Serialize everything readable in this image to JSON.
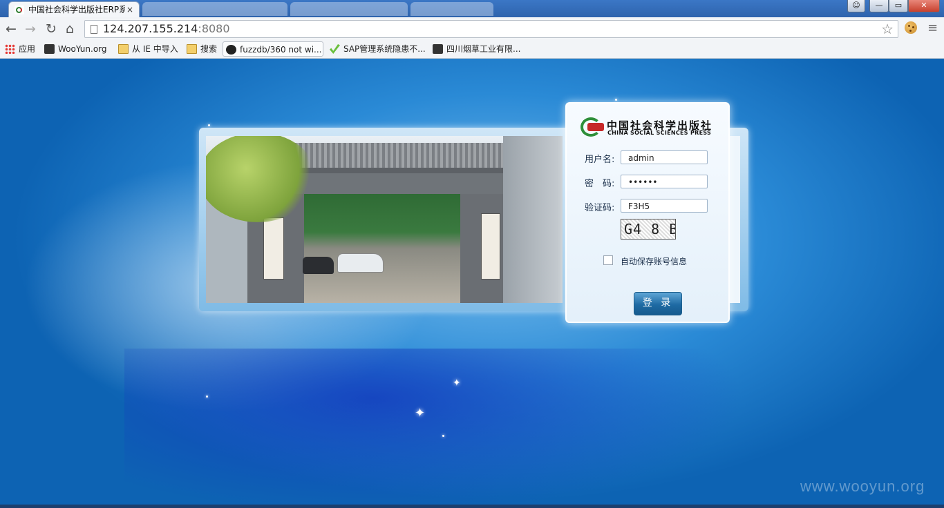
{
  "browser": {
    "tab_active_title": "中国社会科学出版社ERP系",
    "tab_close": "×",
    "url_host": "124.207.155.214",
    "url_port": ":8080",
    "window_controls": {
      "minimize": "—",
      "maximize": "▭",
      "close": "✕"
    }
  },
  "bookmarks": [
    {
      "label": "应用",
      "icon": "apps-icon"
    },
    {
      "label": "WooYun.org",
      "icon": "wooyun-icon"
    },
    {
      "label": "从 IE 中导入",
      "icon": "folder-icon"
    },
    {
      "label": "搜索",
      "icon": "folder-icon"
    },
    {
      "label": "fuzzdb/360 not wi...",
      "icon": "github-icon"
    },
    {
      "label": "SAP管理系统隐患不...",
      "icon": "sap-icon"
    },
    {
      "label": "四川烟草工业有限...",
      "icon": "wooyun-icon"
    }
  ],
  "login": {
    "logo_cn": "中国社会科学出版社",
    "logo_en": "CHINA SOCIAL SCIENCES PRESS",
    "username_label": "用户名:",
    "username_value": "admin",
    "password_label": "密　码:",
    "password_value": "••••••",
    "captcha_label": "验证码:",
    "captcha_value": "F3H5",
    "captcha_image_text": "G4 8 B",
    "remember_label": "自动保存账号信息",
    "login_button": "登 录"
  },
  "watermark": "www.wooyun.org"
}
